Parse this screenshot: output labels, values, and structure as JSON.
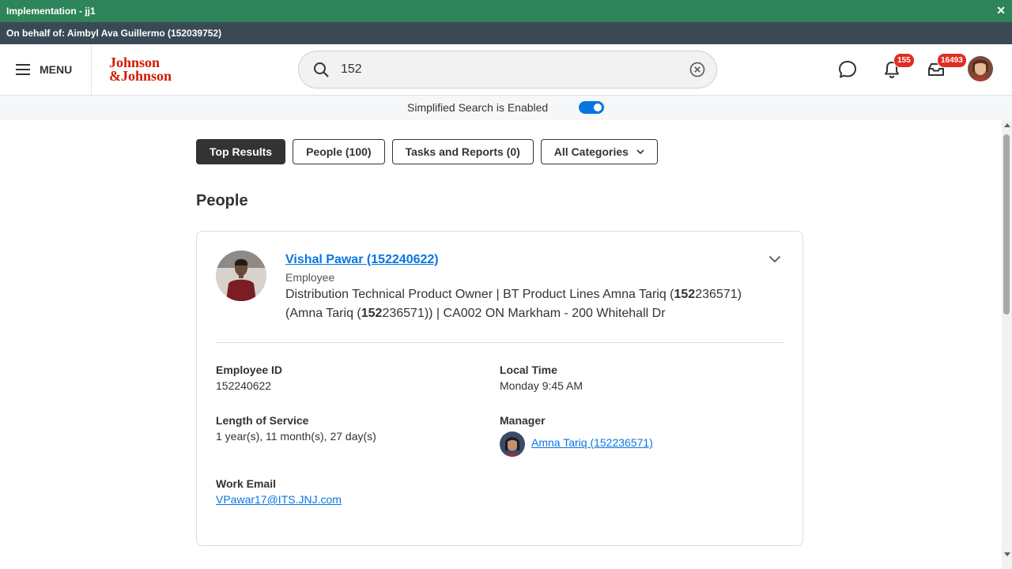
{
  "window": {
    "title": "Implementation - jj1",
    "close_glyph": "✕",
    "on_behalf": "On behalf of: Aimbyl Ava Guillermo (152039752)"
  },
  "header": {
    "menu_label": "MENU",
    "logo_line1": "Johnson",
    "logo_line2": "&Johnson",
    "search_value": "152",
    "notifications_count": "155",
    "inbox_count": "16493"
  },
  "simplified": {
    "text": "Simplified Search is Enabled",
    "enabled": true
  },
  "tabs": [
    {
      "label": "Top Results",
      "active": true
    },
    {
      "label": "People (100)",
      "active": false
    },
    {
      "label": "Tasks and Reports (0)",
      "active": false
    },
    {
      "label": "All Categories",
      "active": false
    }
  ],
  "section": {
    "title": "People"
  },
  "person": {
    "name": "Vishal Pawar (152240622)",
    "role": "Employee",
    "desc_1": "Distribution Technical Product Owner | BT Product Lines Amna Tariq (",
    "desc_2": "152",
    "desc_3": "236571)",
    "desc_4": "(Amna Tariq (",
    "desc_5": "152",
    "desc_6": "236571)) | CA002 ON Markham - 200 Whitehall Dr",
    "employee_id_label": "Employee ID",
    "employee_id": "152240622",
    "local_time_label": "Local Time",
    "local_time": "Monday 9:45 AM",
    "service_label": "Length of Service",
    "service": "1 year(s), 11 month(s), 27 day(s)",
    "manager_label": "Manager",
    "manager": "Amna Tariq (152236571)",
    "email_label": "Work Email",
    "email": "VPawar17@ITS.JNJ.com"
  },
  "colors": {
    "brand_green": "#2e845b",
    "link_blue": "#0875e1",
    "logo_red": "#d51900",
    "badge_red": "#de2e21"
  }
}
